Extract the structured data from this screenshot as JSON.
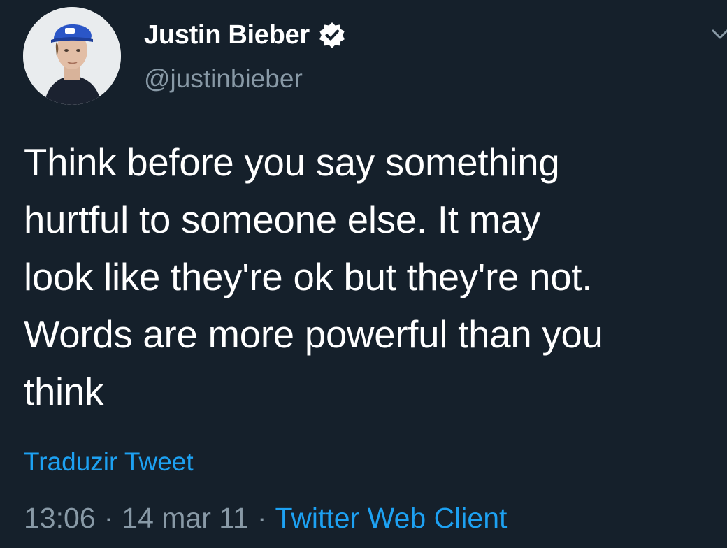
{
  "author": {
    "display_name": "Justin Bieber",
    "handle": "@justinbieber",
    "verified_icon": "verified-badge-icon",
    "avatar_icon": "avatar-photo"
  },
  "tweet": {
    "lines": [
      "Think before you say something",
      "hurtful to someone else. It may",
      "look like they're ok but they're not.",
      "Words are more powerful than you",
      "think"
    ],
    "translate_label": "Traduzir Tweet",
    "time": "13:06",
    "date": "14 mar 11",
    "separator": "·",
    "client": "Twitter Web Client"
  },
  "menu": {
    "icon": "chevron-down-icon"
  },
  "colors": {
    "background": "#15202b",
    "text": "#ffffff",
    "secondary": "#8899a6",
    "accent": "#1da1f2"
  }
}
